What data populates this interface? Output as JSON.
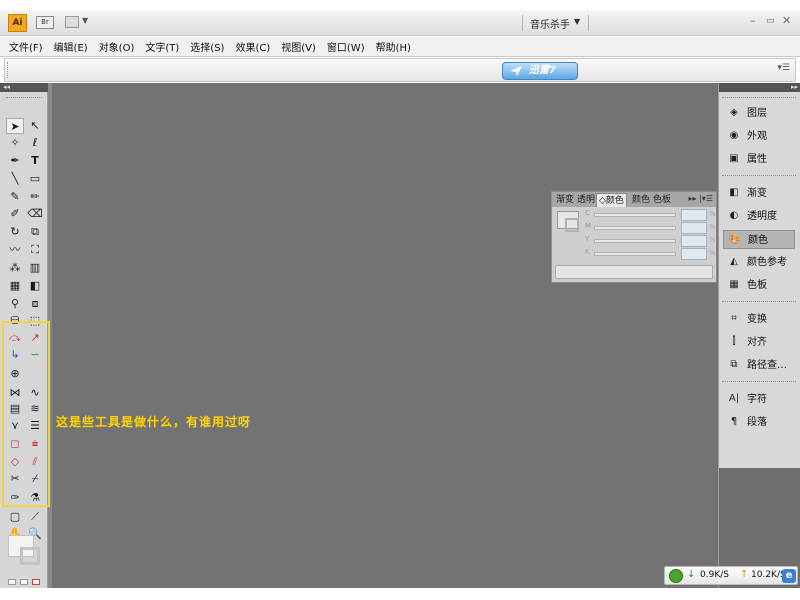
{
  "app": {
    "logo_text": "Ai",
    "bridge_label": "Br",
    "workspace_name": "音乐杀手",
    "window_controls": {
      "minimize": "–",
      "restore": "🗗",
      "close": "✕"
    }
  },
  "menu": [
    "文件(F)",
    "编辑(E)",
    "对象(O)",
    "文字(T)",
    "选择(S)",
    "效果(C)",
    "视图(V)",
    "窗口(W)",
    "帮助(H)"
  ],
  "control_bar": {
    "xunlei_label": "迅雷7"
  },
  "annotation_text": "这是些工具是做什么，有谁用过呀",
  "color_panel": {
    "tabs": [
      "渐变",
      "透明",
      "颜色",
      "颜色",
      "色板"
    ],
    "channels": [
      "C",
      "M",
      "Y",
      "K"
    ]
  },
  "dock": {
    "groups": [
      [
        {
          "label": "图层",
          "icon": "layers-icon"
        },
        {
          "label": "外观",
          "icon": "appearance-icon"
        },
        {
          "label": "属性",
          "icon": "attributes-icon"
        }
      ],
      [
        {
          "label": "渐变",
          "icon": "gradient-icon"
        },
        {
          "label": "透明度",
          "icon": "transparency-icon"
        },
        {
          "label": "颜色",
          "icon": "color-icon",
          "active": true
        },
        {
          "label": "颜色参考",
          "icon": "color-guide-icon"
        },
        {
          "label": "色板",
          "icon": "swatches-icon"
        }
      ],
      [
        {
          "label": "变换",
          "icon": "transform-icon"
        },
        {
          "label": "对齐",
          "icon": "align-icon"
        },
        {
          "label": "路径查…",
          "icon": "pathfinder-icon"
        }
      ],
      [
        {
          "label": "字符",
          "icon": "character-icon"
        },
        {
          "label": "段落",
          "icon": "paragraph-icon"
        }
      ]
    ]
  },
  "net_meter": {
    "download": "0.9K/S",
    "upload": "10.2K/S"
  },
  "colors": {
    "canvas": "#737373",
    "highlight": "#efd43c",
    "annotation": "#ffd400",
    "accent_logo": "#f5a81d"
  }
}
